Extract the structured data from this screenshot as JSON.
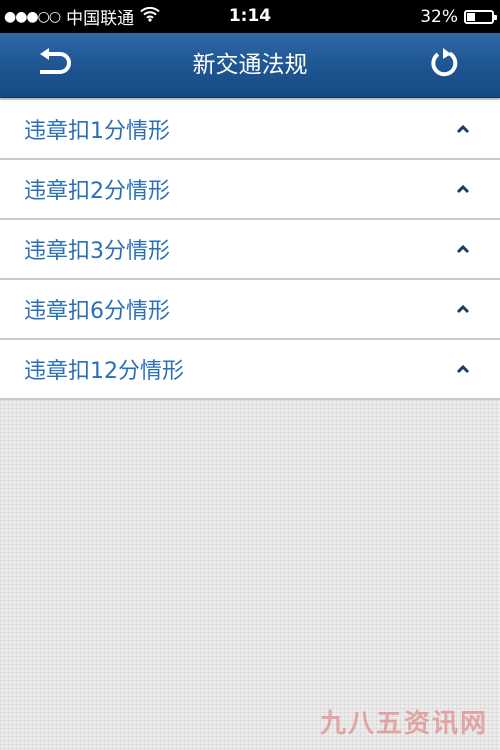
{
  "status_bar": {
    "signal": "●●●○○",
    "carrier": "中国联通",
    "wifi_icon": "wifi-icon",
    "time": "1:14",
    "battery_percent": "32%",
    "battery_level": 0.32
  },
  "nav": {
    "title": "新交通法规",
    "back_icon": "back-arrow-icon",
    "refresh_icon": "refresh-icon"
  },
  "list": {
    "items": [
      {
        "label": "违章扣1分情形"
      },
      {
        "label": "违章扣2分情形"
      },
      {
        "label": "违章扣3分情形"
      },
      {
        "label": "违章扣6分情形"
      },
      {
        "label": "违章扣12分情形"
      }
    ],
    "chevron_icon": "chevron-up-icon"
  },
  "watermark": "九八五资讯网",
  "colors": {
    "nav_bar": "#1e5693",
    "item_text": "#2a6fb8",
    "chevron": "#1f3d66",
    "background": "#ececec"
  }
}
